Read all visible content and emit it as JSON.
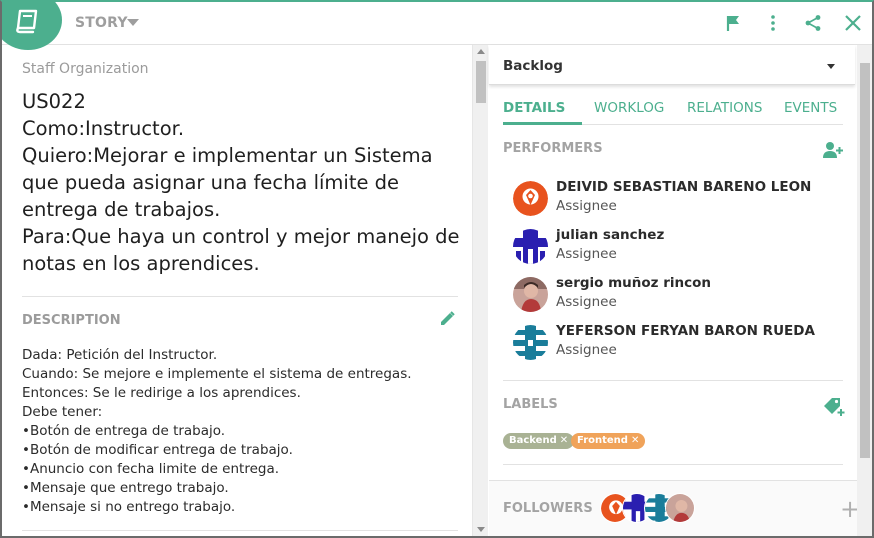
{
  "header": {
    "type_label": "STORY",
    "icons": [
      "book-icon",
      "flag-icon",
      "more-vert-icon",
      "share-icon",
      "close-icon"
    ],
    "accent": "#4caf8e"
  },
  "left": {
    "org": "Staff Organization",
    "story_lines": [
      "US022",
      "Como:Instructor.",
      "Quiero:Mejorar e implementar un Sistema que pueda asignar una fecha límite de entrega de trabajos.",
      "Para:Que haya un control y mejor manejo de notas en los aprendices."
    ],
    "description_title": "DESCRIPTION",
    "description_lines": [
      "Dada: Petición del Instructor.",
      "Cuando: Se mejore e implemente el sistema de entregas.",
      "Entonces: Se le redirige a los aprendices.",
      "Debe tener:",
      "•Botón de entrega de trabajo.",
      "•Botón de modificar entrega de trabajo.",
      "•Anuncio con fecha limite de entrega.",
      "•Mensaje que entrego trabajo.",
      "•Mensaje si no entrego trabajo."
    ]
  },
  "right": {
    "status": "Backlog",
    "tabs": [
      "DETAILS",
      "WORKLOG",
      "RELATIONS",
      "EVENTS"
    ],
    "active_tab": "DETAILS",
    "performers_title": "PERFORMERS",
    "performers": [
      {
        "name": "DEIVID SEBASTIAN BARENO LEON",
        "role": "Assignee",
        "avatar": "orange-avatar-icon"
      },
      {
        "name": "julian sanchez",
        "role": "Assignee",
        "avatar": "blue-pattern-avatar-icon"
      },
      {
        "name": "sergio muñoz rincon",
        "role": "Assignee",
        "avatar": "photo-avatar-icon"
      },
      {
        "name": "YEFERSON FERYAN BARON RUEDA",
        "role": "Assignee",
        "avatar": "teal-pattern-avatar-icon"
      }
    ],
    "labels_title": "LABELS",
    "labels": [
      {
        "text": "Backend",
        "color": "#a9b294"
      },
      {
        "text": "Frontend",
        "color": "#f0a35a"
      }
    ],
    "followers_title": "FOLLOWERS"
  }
}
